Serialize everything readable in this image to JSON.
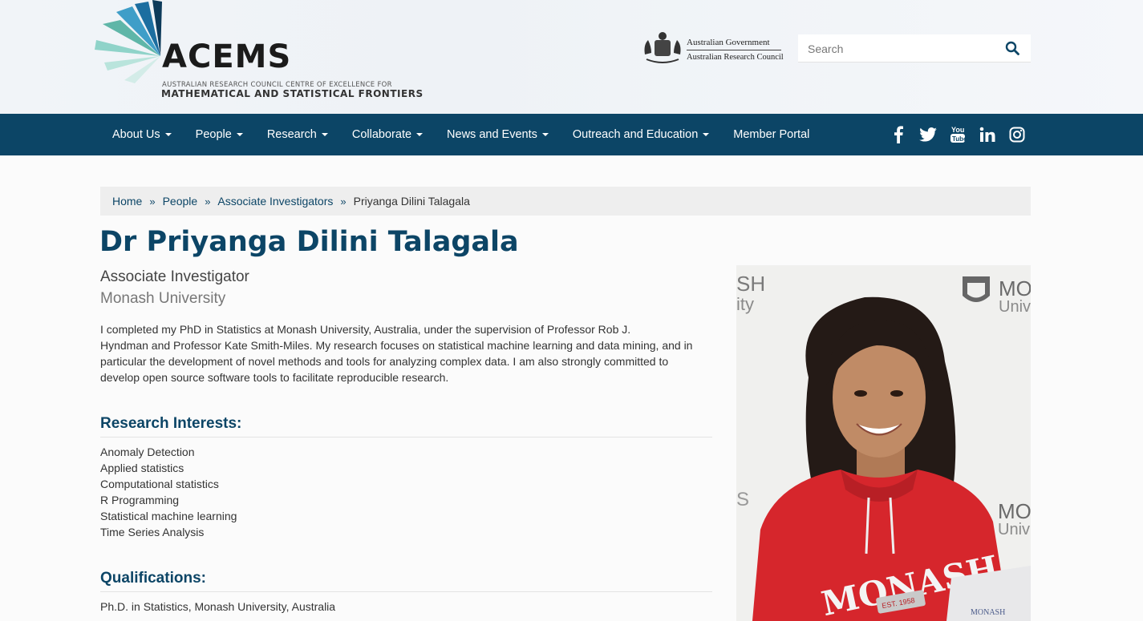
{
  "header": {
    "logo": {
      "wordmark": "ACEMS",
      "subtitle_line1": "AUSTRALIAN RESEARCH COUNCIL CENTRE OF EXCELLENCE FOR",
      "subtitle_line2": "MATHEMATICAL AND STATISTICAL FRONTIERS"
    },
    "government": {
      "line1": "Australian Government",
      "line2": "Australian Research Council"
    },
    "search": {
      "placeholder": "Search",
      "icon": "search-icon"
    }
  },
  "nav": {
    "items": [
      {
        "label": "About Us",
        "dropdown": true
      },
      {
        "label": "People",
        "dropdown": true
      },
      {
        "label": "Research",
        "dropdown": true
      },
      {
        "label": "Collaborate",
        "dropdown": true
      },
      {
        "label": "News and Events",
        "dropdown": true
      },
      {
        "label": "Outreach and Education",
        "dropdown": true
      },
      {
        "label": "Member Portal",
        "dropdown": false
      }
    ],
    "social": [
      "facebook-icon",
      "twitter-icon",
      "youtube-icon",
      "linkedin-icon",
      "instagram-icon"
    ],
    "background": "#0c4566"
  },
  "breadcrumb": {
    "items": [
      "Home",
      "People",
      "Associate Investigators"
    ],
    "current": "Priyanga Dilini Talagala",
    "separator": "»"
  },
  "profile": {
    "name": "Dr Priyanga Dilini Talagala",
    "role": "Associate Investigator",
    "institution": "Monash University",
    "bio_lines": [
      "I completed my PhD in Statistics at Monash University, Australia, under the supervision of Professor Rob J.",
      "Hyndman and Professor Kate Smith-Miles. My research focuses on statistical machine learning and data mining, and in",
      "particular the development of novel methods and tools for analyzing complex data. I am also strongly committed to",
      "develop open source software tools to facilitate reproducible research."
    ],
    "interests_heading": "Research Interests:",
    "interests": [
      "Anomaly Detection",
      "Applied statistics",
      "Computational statistics",
      "R Programming",
      "Statistical machine learning",
      "Time Series Analysis"
    ],
    "qualifications_heading": "Qualifications:",
    "qualifications": [
      "Ph.D. in Statistics, Monash University, Australia"
    ],
    "photo": {
      "backdrop_text_left_1": "SH",
      "backdrop_text_left_2": "ity",
      "backdrop_text_right_1": "MO",
      "backdrop_text_right_2": "Univ",
      "backdrop_text_right_3": "MO",
      "backdrop_text_right_4": "Univ",
      "hoodie_text": "MONASH",
      "hoodie_badge": "EST. 1958",
      "folder_text": "MONASH"
    }
  },
  "colors": {
    "brand_blue": "#0c4566",
    "hoodie_red": "#d6262c"
  }
}
